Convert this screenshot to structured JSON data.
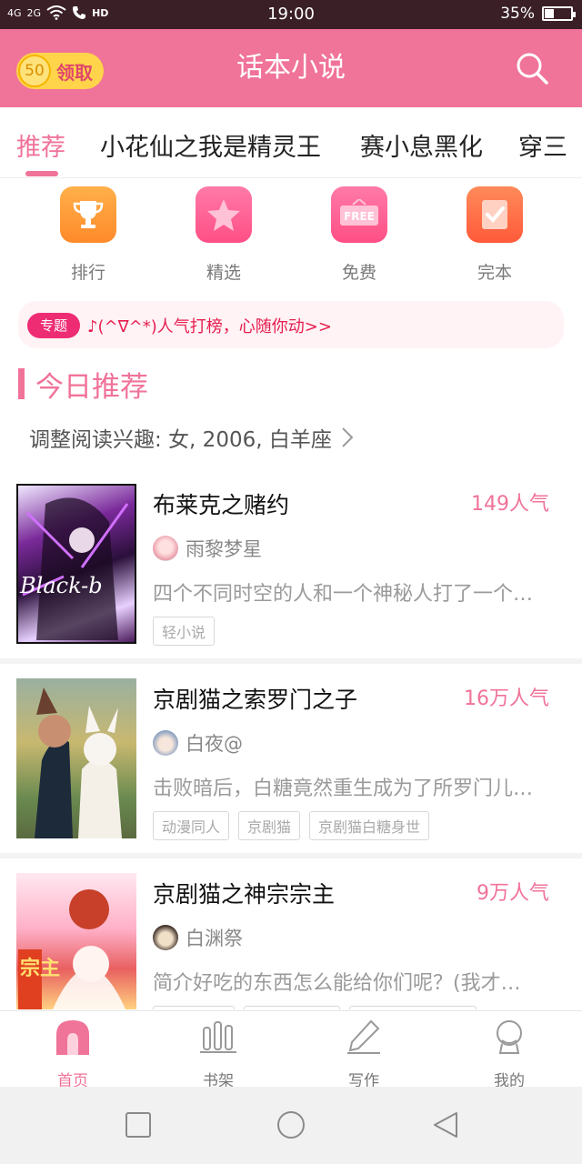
{
  "status_bar": {
    "network": [
      "4G",
      "2G"
    ],
    "volte": "HD",
    "time": "19:00",
    "battery_percent": "35%",
    "battery_level": 0.35
  },
  "header": {
    "coin_count": "50",
    "claim_label": "领取",
    "title": "话本小说",
    "search_icon": "search-icon",
    "colors": {
      "primary": "#f07399",
      "coin": "#ffd44a"
    }
  },
  "tabs": [
    {
      "label": "推荐",
      "active": true
    },
    {
      "label": "小花仙之我是精灵王",
      "active": false
    },
    {
      "label": "赛小息黑化",
      "active": false
    },
    {
      "label": "穿三",
      "active": false
    }
  ],
  "categories": [
    {
      "label": "排行",
      "icon": "trophy-icon",
      "color": "#ff9a3c"
    },
    {
      "label": "精选",
      "icon": "star-icon",
      "color": "#ff5c8f"
    },
    {
      "label": "免费",
      "icon": "free-sign-icon",
      "color": "#ff5c8f"
    },
    {
      "label": "完本",
      "icon": "checkbook-icon",
      "color": "#ff6a3d"
    }
  ],
  "topic": {
    "badge": "专题",
    "text": "♪(^∇^*)人气打榜，心随你动>>"
  },
  "recommend": {
    "title": "今日推荐",
    "interest": "调整阅读兴趣: 女, 2006, 白羊座"
  },
  "books": [
    {
      "title": "布莱克之赌约",
      "popularity": "149人气",
      "author": "雨黎梦星",
      "description": "四个不同时空的人和一个神秘人打了一个…",
      "tags": [
        "轻小说"
      ],
      "cover_text": "Black-b"
    },
    {
      "title": "京剧猫之索罗门之子",
      "popularity": "16万人气",
      "author": "白夜@",
      "description": "击败暗后，白糖竟然重生成为了所罗门儿…",
      "tags": [
        "动漫同人",
        "京剧猫",
        "京剧猫白糖身世"
      ],
      "cover_text": ""
    },
    {
      "title": "京剧猫之神宗宗主",
      "popularity": "9万人气",
      "author": "白渊祭",
      "description": "简介好吃的东西怎么能给你们呢？(我才…",
      "tags": [
        "",
        "",
        ""
      ],
      "cover_text": "宗主"
    }
  ],
  "bottom_nav": [
    {
      "label": "首页",
      "icon": "home-icon",
      "active": true
    },
    {
      "label": "书架",
      "icon": "bookshelf-icon",
      "active": false
    },
    {
      "label": "写作",
      "icon": "pen-icon",
      "active": false
    },
    {
      "label": "我的",
      "icon": "profile-icon",
      "active": false
    }
  ],
  "system_nav": [
    "recent-apps-icon",
    "home-circle-icon",
    "back-icon"
  ]
}
